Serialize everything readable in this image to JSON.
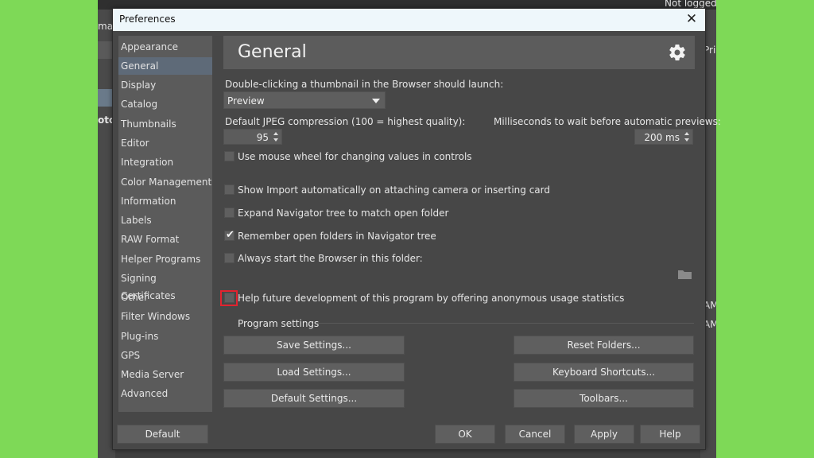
{
  "background_app": {
    "top_right_text": "Not logged",
    "left_fragments": [
      "ma",
      "oto"
    ],
    "right_fragments": [
      "Pri",
      "AM",
      "AM"
    ]
  },
  "dialog": {
    "title": "Preferences",
    "close_glyph": "✕"
  },
  "sidebar": {
    "items": [
      {
        "label": "Appearance"
      },
      {
        "label": "General",
        "active": true
      },
      {
        "label": "Display"
      },
      {
        "label": "Catalog"
      },
      {
        "label": "Thumbnails"
      },
      {
        "label": "Editor"
      },
      {
        "label": "Integration"
      },
      {
        "label": "Color Management"
      },
      {
        "label": "Information"
      },
      {
        "label": "Labels"
      },
      {
        "label": "RAW Format"
      },
      {
        "label": "Helper Programs"
      },
      {
        "label": "Signing Certificates"
      },
      {
        "label": "Other"
      },
      {
        "label": "Filter Windows"
      },
      {
        "label": "Plug-ins"
      },
      {
        "label": "GPS"
      },
      {
        "label": "Media Server"
      },
      {
        "label": "Advanced"
      }
    ]
  },
  "general": {
    "heading": "General",
    "icon": "gear-icon",
    "launch_label": "Double-clicking a thumbnail in the Browser should launch:",
    "launch_value": "Preview",
    "jpeg_label": "Default JPEG compression (100 = highest quality):",
    "jpeg_value": "95",
    "preview_wait_label": "Milliseconds to wait before automatic previews:",
    "preview_wait_value": "200 ms",
    "checkboxes": [
      {
        "label": "Use mouse wheel for changing values in controls",
        "checked": false
      },
      {
        "label": "Show Import automatically on attaching camera or inserting card",
        "checked": false
      },
      {
        "label": "Expand Navigator tree to match open folder",
        "checked": false
      },
      {
        "label": "Remember open folders in Navigator tree",
        "checked": true
      },
      {
        "label": "Always start the Browser in this folder:",
        "checked": false
      },
      {
        "label": "Help future development of this program by offering anonymous usage statistics",
        "checked": false
      }
    ],
    "program_settings_label": "Program settings",
    "buttons_left": [
      "Save Settings...",
      "Load Settings...",
      "Default Settings..."
    ],
    "buttons_right": [
      "Reset Folders...",
      "Keyboard Shortcuts...",
      "Toolbars..."
    ]
  },
  "footer": {
    "default": "Default",
    "ok": "OK",
    "cancel": "Cancel",
    "apply": "Apply",
    "help": "Help"
  },
  "colors": {
    "accent_highlight": "#e2232f",
    "desktop_bg": "#7ed957"
  }
}
